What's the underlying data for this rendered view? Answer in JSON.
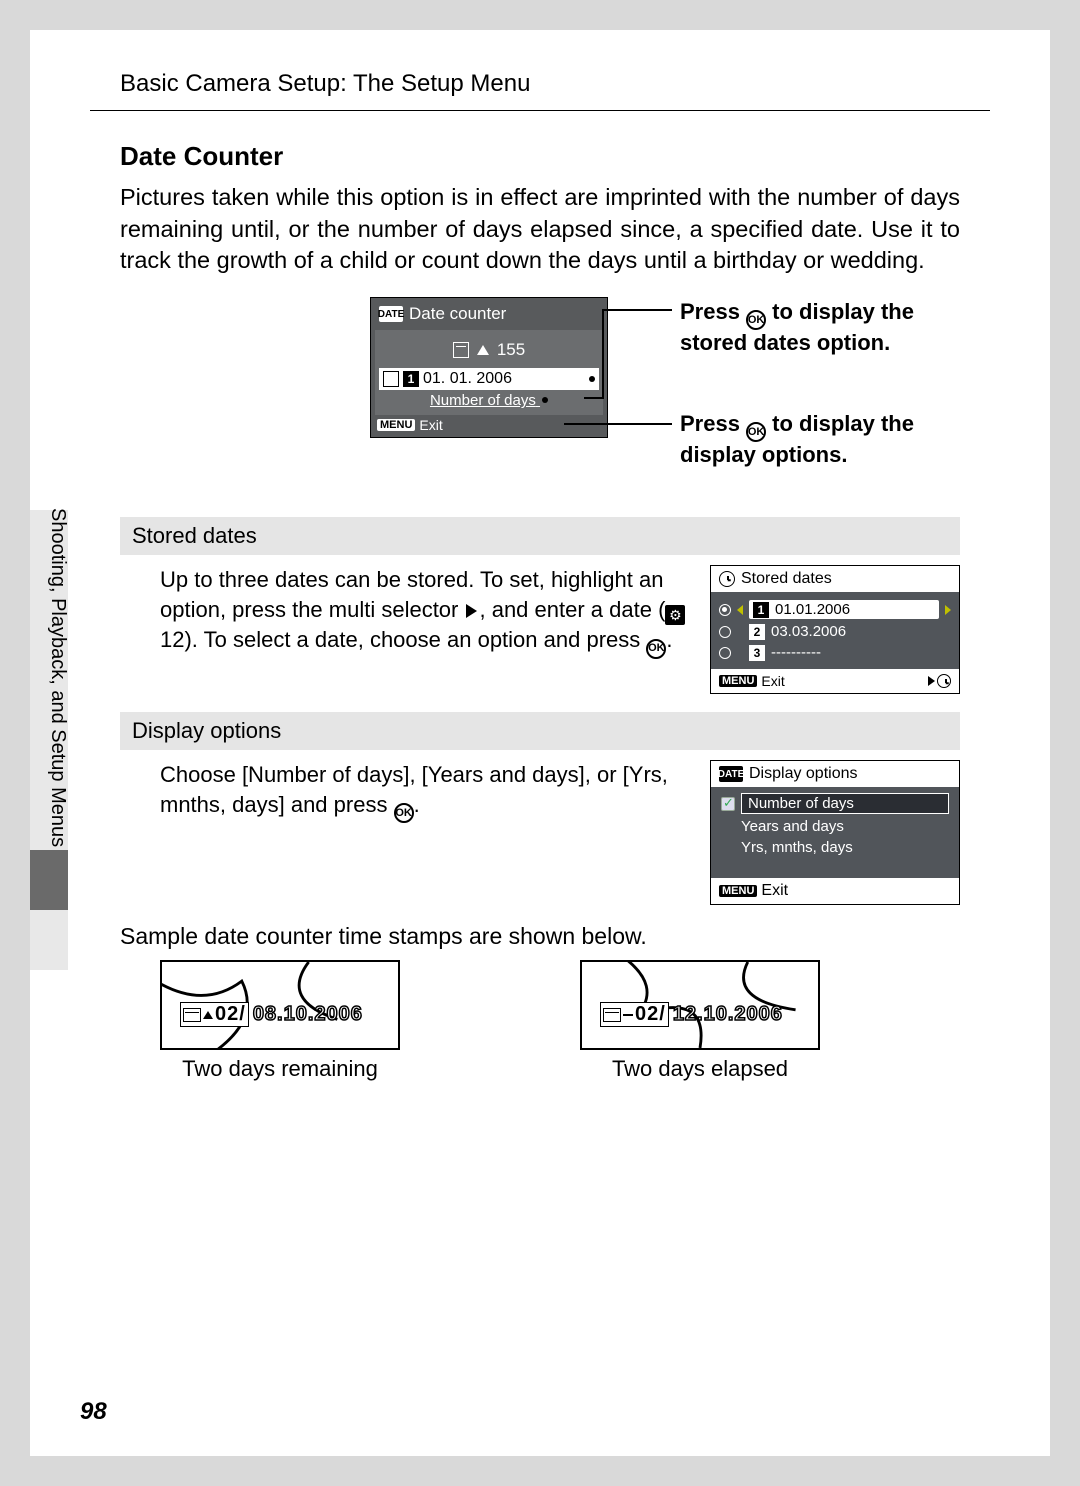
{
  "page_number": "98",
  "header": "Basic Camera Setup: The Setup Menu",
  "side_label": "Shooting, Playback, and Setup Menus",
  "section_title": "Date Counter",
  "intro": "Pictures taken while this option is in effect are imprinted with the number of days remaining until, or the number of days elapsed since, a specified date. Use it to track the growth of a child or count down the days until a birthday or wedding.",
  "lcd1": {
    "icon_label": "DATE",
    "title": "Date counter",
    "count": "155",
    "date_slot_num": "1",
    "date_value": "01. 01. 2006",
    "subline": "Number of days",
    "menu_label": "MENU",
    "exit_label": "Exit"
  },
  "callout1a": "Press ",
  "callout1b": " to display the stored dates option.",
  "callout2a": "Press ",
  "callout2b": " to display the display options.",
  "sub1_h": "Stored dates",
  "sub1_text_a": "Up to three dates can be stored. To set, highlight an option, press the multi selector ",
  "sub1_text_b": ", and enter a date (",
  "sub1_page_ref": " 12). To select a date, choose an option and press ",
  "sub1_text_c": ".",
  "stored_lcd": {
    "title": "Stored dates",
    "rows": [
      {
        "n": "1",
        "val": "01.01.2006",
        "selected": true
      },
      {
        "n": "2",
        "val": "03.03.2006",
        "selected": false
      },
      {
        "n": "3",
        "val": "----------",
        "selected": false
      }
    ],
    "menu_label": "MENU",
    "exit_label": "Exit"
  },
  "sub2_h": "Display options",
  "sub2_text_a": "Choose [Number of days], [Years and days], or [Yrs, mnths, days] and press ",
  "sub2_text_b": ".",
  "display_lcd": {
    "icon_label": "DATE",
    "title": "Display options",
    "rows": [
      "Number of days",
      "Years and days",
      "Yrs, mnths, days"
    ],
    "menu_label": "MENU",
    "exit_label": "Exit"
  },
  "samples_intro": "Sample date counter time stamps are shown below.",
  "sample_left": {
    "stamp_num": "02/",
    "stamp_date": "08.10.2006",
    "caption": "Two days remaining"
  },
  "sample_right": {
    "stamp_num": "02/",
    "stamp_date": "12.10.2006",
    "caption": "Two days elapsed"
  }
}
